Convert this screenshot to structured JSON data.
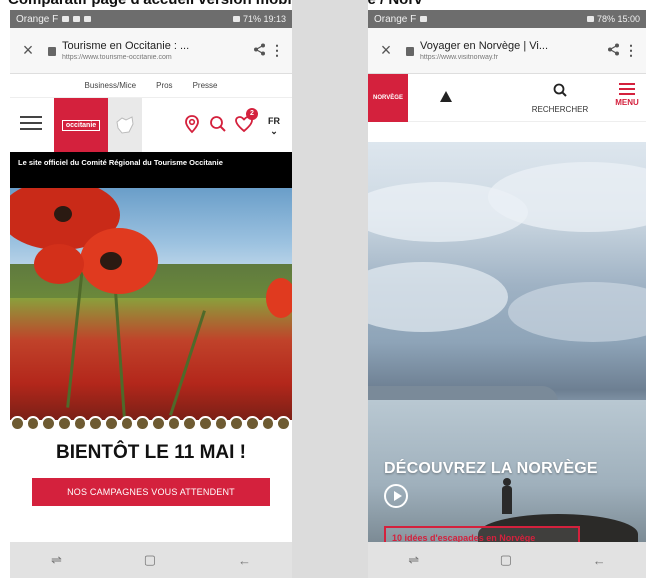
{
  "top_caption": "Comparatif page d'accueil version mobile Occitanie / Norv",
  "left_phone": {
    "status": {
      "carrier": "Orange F",
      "right": "71% 19:13"
    },
    "browser": {
      "title": "Tourisme en Occitanie : ...",
      "url": "https://www.tourisme-occitanie.com"
    },
    "top_nav": [
      "Business/Mice",
      "Pros",
      "Presse"
    ],
    "logo_text": "occitanie",
    "badge_count": "2",
    "lang": {
      "code": "FR",
      "chevron": "⌄"
    },
    "official_banner": "Le site officiel du Comité Régional du Tourisme Occitanie",
    "headline": "BIENTÔT LE 11 MAI !",
    "cta": "NOS CAMPAGNES VOUS ATTENDENT",
    "nav_buttons": {
      "recent": "⇌",
      "home": "▢",
      "back": "←"
    }
  },
  "right_phone": {
    "status": {
      "carrier": "Orange F",
      "right": "78% 15:00"
    },
    "browser": {
      "title": "Voyager en Norvège | Vi...",
      "url": "https://www.visitnorway.fr"
    },
    "logo_text": "NORVÈGE",
    "search_label": "RECHERCHER",
    "menu_label": "MENU",
    "headline": "DÉCOUVREZ LA NORVÈGE",
    "ideas_link": "10 idées d'escapades en Norvège",
    "nav_buttons": {
      "recent": "⇌",
      "home": "▢",
      "back": "←"
    }
  },
  "colors": {
    "brand_red": "#d4213d",
    "status_bar": "#6d6d6d",
    "nav_bar": "#e2e2e2"
  }
}
